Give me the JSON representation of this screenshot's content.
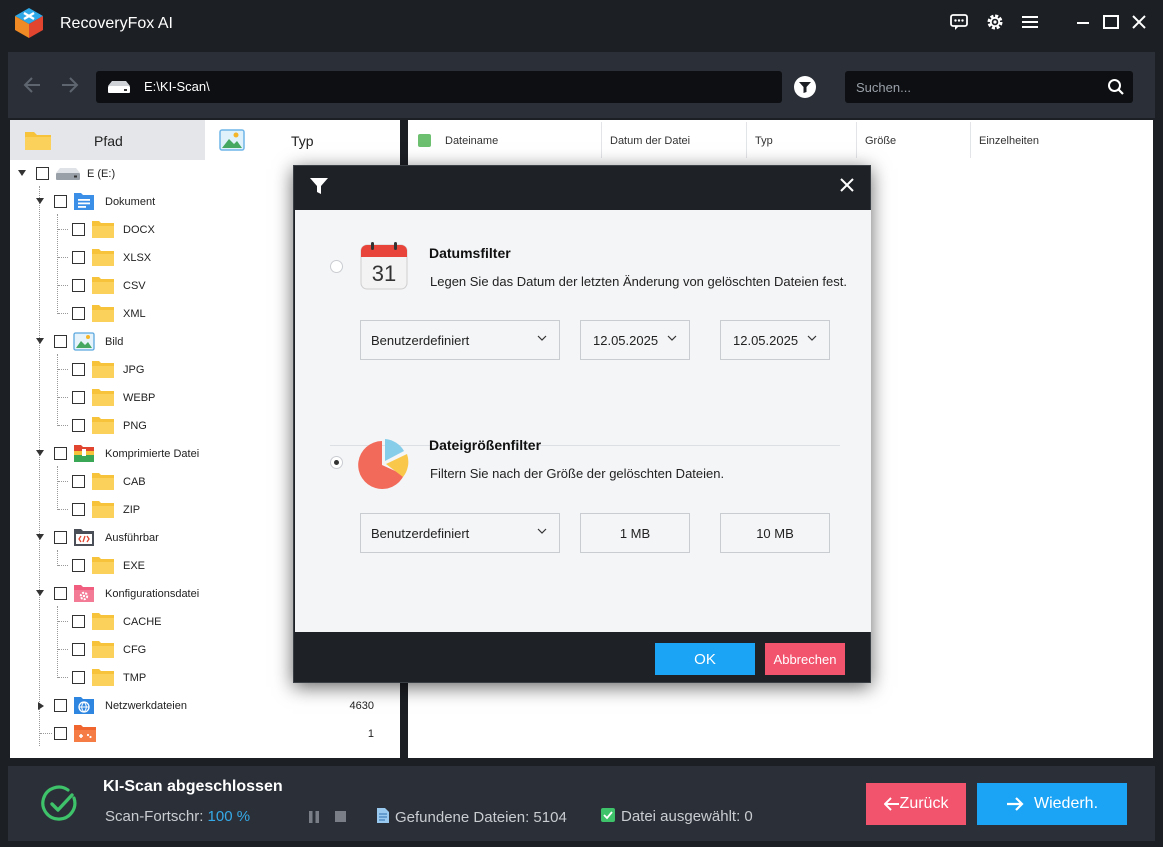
{
  "app": {
    "title": "RecoveryFox AI"
  },
  "titlebar_icons": [
    "feedback-icon",
    "settings-icon",
    "menu-icon",
    "minimize-icon",
    "maximize-icon",
    "close-icon"
  ],
  "nav": {
    "path": "E:\\KI-Scan\\",
    "search_placeholder": "Suchen..."
  },
  "tabs": [
    {
      "label": "Pfad"
    },
    {
      "label": "Typ"
    }
  ],
  "tree": [
    {
      "label": "E (E:)",
      "count": ""
    },
    {
      "label": "Dokument",
      "count": ""
    },
    {
      "label": "DOCX",
      "count": ""
    },
    {
      "label": "XLSX",
      "count": ""
    },
    {
      "label": "CSV",
      "count": ""
    },
    {
      "label": "XML",
      "count": ""
    },
    {
      "label": "Bild",
      "count": ""
    },
    {
      "label": "JPG",
      "count": ""
    },
    {
      "label": "WEBP",
      "count": ""
    },
    {
      "label": "PNG",
      "count": ""
    },
    {
      "label": "Komprimierte Datei",
      "count": ""
    },
    {
      "label": "CAB",
      "count": ""
    },
    {
      "label": "ZIP",
      "count": ""
    },
    {
      "label": "Ausführbar",
      "count": ""
    },
    {
      "label": "EXE",
      "count": ""
    },
    {
      "label": "Konfigurationsdatei",
      "count": ""
    },
    {
      "label": "CACHE",
      "count": ""
    },
    {
      "label": "CFG",
      "count": ""
    },
    {
      "label": "TMP",
      "count": ""
    },
    {
      "label": "Netzwerkdateien",
      "count": "4630"
    },
    {
      "label": "",
      "count": "1"
    }
  ],
  "columns": [
    {
      "label": "Dateiname"
    },
    {
      "label": "Datum der Datei"
    },
    {
      "label": "Typ"
    },
    {
      "label": "Größe"
    },
    {
      "label": "Einzelheiten"
    }
  ],
  "modal": {
    "date_filter": {
      "title": "Datumsfilter",
      "desc": "Legen Sie das Datum der letzten Änderung von gelöschten Dateien fest.",
      "calendar_day": "31",
      "mode": "Benutzerdefiniert",
      "from": "12.05.2025",
      "to": "12.05.2025"
    },
    "size_filter": {
      "title": "Dateigrößenfilter",
      "desc": "Filtern Sie nach der Größe der gelöschten Dateien.",
      "mode": "Benutzerdefiniert",
      "min": "1 MB",
      "max": "10 MB"
    },
    "ok_label": "OK",
    "cancel_label": "Abbrechen"
  },
  "status": {
    "title": "KI-Scan abgeschlossen",
    "progress_label": "Scan-Fortschr: ",
    "progress_value": "100 %",
    "found": "Gefundene Dateien: 5104",
    "selected": "Datei ausgewählt: 0",
    "back_label": "Zurück",
    "restore_label": "Wiederh."
  },
  "colors": {
    "accent_blue": "#1ba4f5",
    "accent_red": "#f2536d",
    "panel_dark": "#2b3038",
    "folder_yellow": "#f7c33b"
  }
}
